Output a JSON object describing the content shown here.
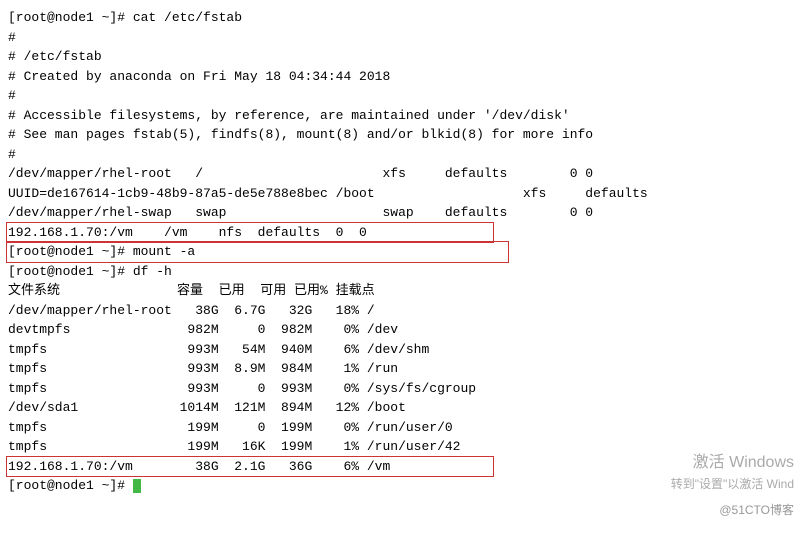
{
  "prompt1": "[root@node1 ~]# cat /etc/fstab",
  "fstab_lines": [
    "",
    "#",
    "# /etc/fstab",
    "# Created by anaconda on Fri May 18 04:34:44 2018",
    "#",
    "# Accessible filesystems, by reference, are maintained under '/dev/disk'",
    "# See man pages fstab(5), findfs(8), mount(8) and/or blkid(8) for more info",
    "#",
    "/dev/mapper/rhel-root   /                       xfs     defaults        0 0",
    "UUID=de167614-1cb9-48b9-87a5-de5e788e8bec /boot                   xfs     defaults",
    "/dev/mapper/rhel-swap   swap                    swap    defaults        0 0"
  ],
  "fstab_highlight": "192.168.1.70:/vm    /vm    nfs  defaults  0  0                ",
  "prompt2": "[root@node1 ~]# mount -a                                        ",
  "prompt3": "[root@node1 ~]# df -h",
  "df_header": "文件系统               容量  已用  可用 已用% 挂载点",
  "df_rows": [
    "/dev/mapper/rhel-root   38G  6.7G   32G   18% /",
    "devtmpfs               982M     0  982M    0% /dev",
    "tmpfs                  993M   54M  940M    6% /dev/shm",
    "tmpfs                  993M  8.9M  984M    1% /run",
    "tmpfs                  993M     0  993M    0% /sys/fs/cgroup",
    "/dev/sda1             1014M  121M  894M   12% /boot",
    "tmpfs                  199M     0  199M    0% /run/user/0",
    "tmpfs                  199M   16K  199M    1% /run/user/42"
  ],
  "df_highlight": "192.168.1.70:/vm        38G  2.1G   36G    6% /vm             ",
  "prompt4": "[root@node1 ~]# ",
  "watermark": {
    "line1": "激活 Windows",
    "line2": "转到\"设置\"以激活 Wind",
    "line3": "@51CTO博客"
  }
}
